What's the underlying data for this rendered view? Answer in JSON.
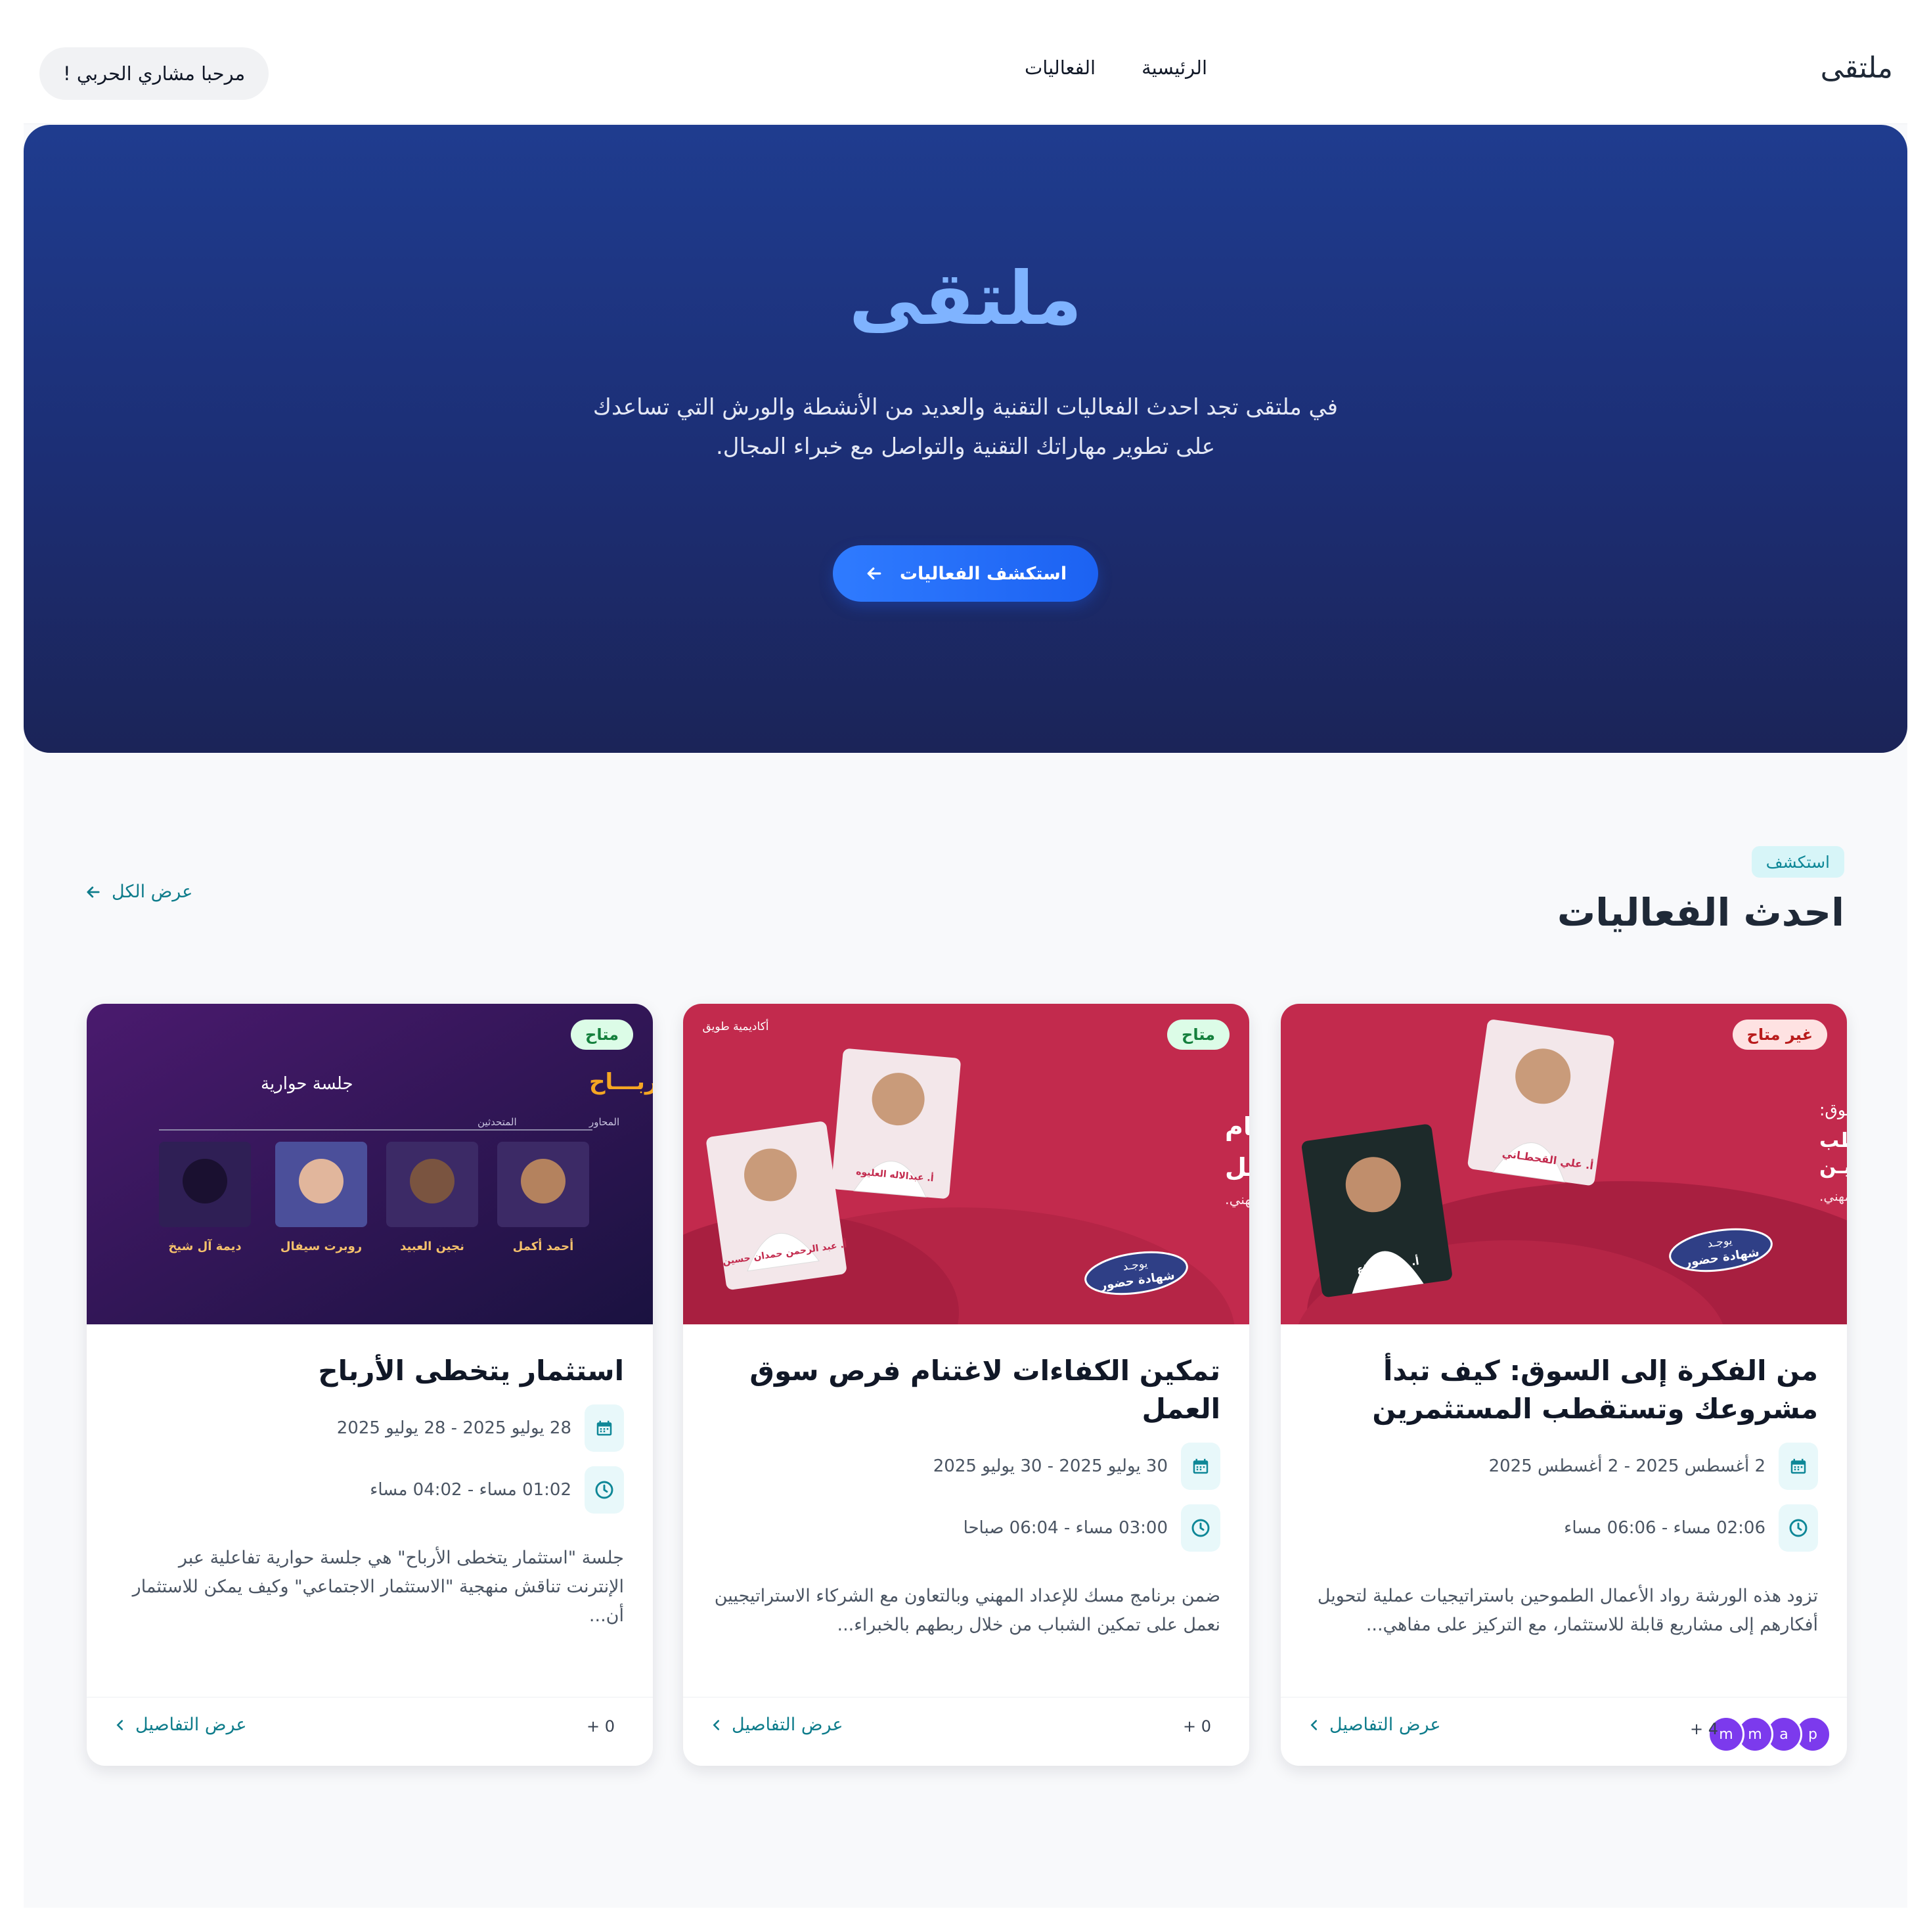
{
  "nav": {
    "brand": "ملتقى",
    "links": [
      "الرئيسية",
      "الفعاليات"
    ],
    "greeting": "مرحبا مشاري الحربي !"
  },
  "hero": {
    "title": "ملتقى",
    "text_line1": "في ملتقى تجد احدث الفعاليات التقنية والعديد من الأنشطة والورش التي تساعدك",
    "text_line2": "على تطوير مهاراتك التقنية والتواصل مع خبراء المجال.",
    "button": "استكشف الفعاليات"
  },
  "section": {
    "badge": "استكشف",
    "title": "احدث الفعاليات",
    "view_all": "عرض الكل"
  },
  "cards": [
    {
      "status": "غير متاح",
      "title": "من الفكرة إلى السوق: كيف تبدأ مشروعك وتستقطب المستثمرين",
      "date": "2 أغسطس 2025 - 2 أغسطس 2025",
      "time": "02:06 مساء - 06:06 مساء",
      "desc": "تزود هذه الورشة رواد الأعمال الطموحين باستراتيجيات عملية لتحويل أفكارهم إلى مشاريع قابلة للاستثمار، مع التركيز على مفاهي...",
      "details": "عرض التفاصيل",
      "attendees_count": "4 +",
      "avatars": [
        "p",
        "a",
        "m",
        "m"
      ],
      "poster": {
        "lead": "من الفـكرة إلى السـوق:",
        "line1": "كيـف تبـدأ مشروعك وتستقطب",
        "line2": "المستثمـريـن",
        "sub": "ضمن برنامج مسك للإعداد المهني.",
        "cert1": "يوجـد",
        "cert2": "شهادة حضور",
        "person1": "أ. علي القحطـاني",
        "person2": "أ. وليد البلاع"
      }
    },
    {
      "status": "متاح",
      "title": "تمكين الكفاءات لاغتنام فرص سوق العمل",
      "date": "30 يوليو 2025 - 30 يوليو 2025",
      "time": "03:00 مساء - 06:04 صباحا",
      "desc": "ضمن برنامج مسك للإعداد المهني وبالتعاون مع الشركاء الاستراتيجيين نعمل على تمكين الشباب من خلال ربطهم بالخبراء...",
      "details": "عرض التفاصيل",
      "attendees_count": "0 +",
      "poster": {
        "line1": "تمكيـن الكفاءات لاغتنام",
        "line2": "فـرص سوق العمل",
        "sub": "ضمن برنامج مسك للإعداد المهني.",
        "cert1": "يوجـد",
        "cert2": "شهادة حضور",
        "person1": "أ. عبدالاله العليوه",
        "person2": "أ. عبد الرحمن حمدان حسين",
        "academy": "أكاديمية طويق"
      }
    },
    {
      "status": "متاح",
      "title": "استثمار يتخطى الأرباح",
      "date": "28 يوليو 2025 - 28 يوليو 2025",
      "time": "01:02 مساء - 04:02 مساء",
      "desc": "جلسة \"استثمار يتخطى الأرباح\" هي جلسة حوارية تفاعلية عبر الإنترنت تناقش منهجية \"الاستثمار الاجتماعي\" وكيف يمكن للاستثمار أن...",
      "details": "عرض التفاصيل",
      "attendees_count": "0 +",
      "poster": {
        "title": "استثمـار يتخطـى الأربـــاح",
        "tag": "جلسة حوارية",
        "moderator": "المحاور",
        "speakers": "المتحدثين",
        "people": [
          "أحمد أكمل",
          "نجين العبيد",
          "روبرت سيفال",
          "ديمة آل شيخ"
        ]
      }
    }
  ],
  "colors": {
    "accent": "#0e7c8b",
    "hero_title": "#7fb3ff",
    "button": "#2f7bff",
    "poster_red": "#c22a4d",
    "poster_purple": "#3a1763",
    "avatar": "#7c3aed"
  }
}
